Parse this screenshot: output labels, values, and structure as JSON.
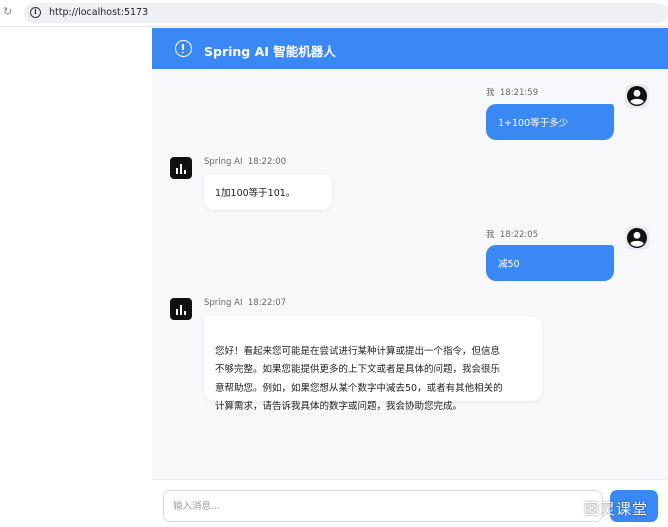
{
  "browser": {
    "url": "http://localhost:5173",
    "reload_icon": "reload-icon",
    "site_info_icon": "info-icon"
  },
  "header": {
    "title": "Spring AI 智能机器人",
    "icon": "alert-circle-icon",
    "bg_color": "#3a88f5"
  },
  "messages": [
    {
      "role": "user",
      "sender": "我",
      "time": "18:21:59",
      "text": "1+100等于多少"
    },
    {
      "role": "bot",
      "sender": "Spring AI",
      "time": "18:22:00",
      "text": "1加100等于101。"
    },
    {
      "role": "user",
      "sender": "我",
      "time": "18:22:05",
      "text": "减50"
    },
    {
      "role": "bot",
      "sender": "Spring AI",
      "time": "18:22:07",
      "text": "您好！看起来您可能是在尝试进行某种计算或提出一个指令，但信息\n不够完整。如果您能提供更多的上下文或者是具体的问题，我会很乐\n意帮助您。例如，如果您想从某个数字中减去50，或者有其他相关的\n计算需求，请告诉我具体的数字或问题，我会协助您完成。"
    }
  ],
  "input": {
    "placeholder": "输入消息...",
    "value": ""
  },
  "send_button": {
    "label": ""
  },
  "watermark": "图灵课堂",
  "colors": {
    "accent": "#3a88f5",
    "bot_avatar": "#111111",
    "chat_bg": "#f7f8fa"
  }
}
